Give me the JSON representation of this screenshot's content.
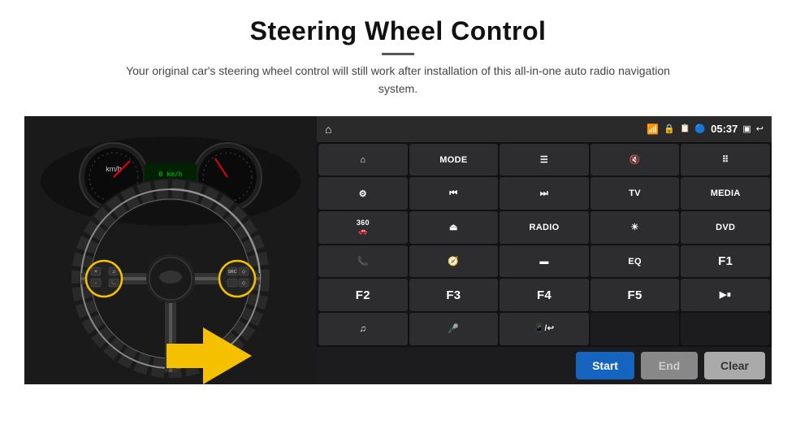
{
  "header": {
    "title": "Steering Wheel Control",
    "subtitle": "Your original car's steering wheel control will still work after installation of this all-in-one auto radio navigation system."
  },
  "status_bar": {
    "wifi_icon": "wifi",
    "lock_icon": "lock",
    "sim_icon": "sim",
    "bluetooth_icon": "bluetooth",
    "time": "05:37",
    "screen_icon": "screen",
    "back_icon": "back"
  },
  "button_grid": [
    {
      "id": "home",
      "label": "",
      "icon": "home",
      "type": "icon"
    },
    {
      "id": "mode",
      "label": "MODE",
      "icon": "",
      "type": "text"
    },
    {
      "id": "list",
      "label": "",
      "icon": "list",
      "type": "icon"
    },
    {
      "id": "vol_mute",
      "label": "",
      "icon": "vol-mute",
      "type": "icon"
    },
    {
      "id": "apps",
      "label": "",
      "icon": "apps",
      "type": "icon"
    },
    {
      "id": "nav",
      "label": "",
      "icon": "nav",
      "type": "icon"
    },
    {
      "id": "prev",
      "label": "",
      "icon": "prev",
      "type": "icon"
    },
    {
      "id": "next",
      "label": "",
      "icon": "next",
      "type": "icon"
    },
    {
      "id": "tv",
      "label": "TV",
      "icon": "",
      "type": "text"
    },
    {
      "id": "media",
      "label": "MEDIA",
      "icon": "",
      "type": "text"
    },
    {
      "id": "cam360",
      "label": "360",
      "icon": "",
      "type": "text-small"
    },
    {
      "id": "eject",
      "label": "",
      "icon": "eject",
      "type": "icon"
    },
    {
      "id": "radio",
      "label": "RADIO",
      "icon": "",
      "type": "text"
    },
    {
      "id": "bright",
      "label": "",
      "icon": "brightness",
      "type": "icon"
    },
    {
      "id": "dvd",
      "label": "DVD",
      "icon": "",
      "type": "text"
    },
    {
      "id": "phone",
      "label": "",
      "icon": "phone",
      "type": "icon"
    },
    {
      "id": "nav2",
      "label": "",
      "icon": "nav2",
      "type": "icon"
    },
    {
      "id": "screen",
      "label": "",
      "icon": "screen",
      "type": "icon"
    },
    {
      "id": "eq",
      "label": "EQ",
      "icon": "",
      "type": "text"
    },
    {
      "id": "f1",
      "label": "F1",
      "icon": "",
      "type": "text"
    },
    {
      "id": "f2",
      "label": "F2",
      "icon": "",
      "type": "text"
    },
    {
      "id": "f3",
      "label": "F3",
      "icon": "",
      "type": "text"
    },
    {
      "id": "f4",
      "label": "F4",
      "icon": "",
      "type": "text"
    },
    {
      "id": "f5",
      "label": "F5",
      "icon": "",
      "type": "text"
    },
    {
      "id": "playpause",
      "label": "",
      "icon": "playpause",
      "type": "icon"
    },
    {
      "id": "music",
      "label": "",
      "icon": "music",
      "type": "icon"
    },
    {
      "id": "mic",
      "label": "",
      "icon": "mic",
      "type": "icon"
    },
    {
      "id": "call",
      "label": "",
      "icon": "call",
      "type": "icon"
    },
    {
      "id": "blank1",
      "label": "",
      "icon": "",
      "type": "empty"
    },
    {
      "id": "blank2",
      "label": "",
      "icon": "",
      "type": "empty"
    }
  ],
  "action_buttons": {
    "start_label": "Start",
    "end_label": "End",
    "clear_label": "Clear"
  }
}
